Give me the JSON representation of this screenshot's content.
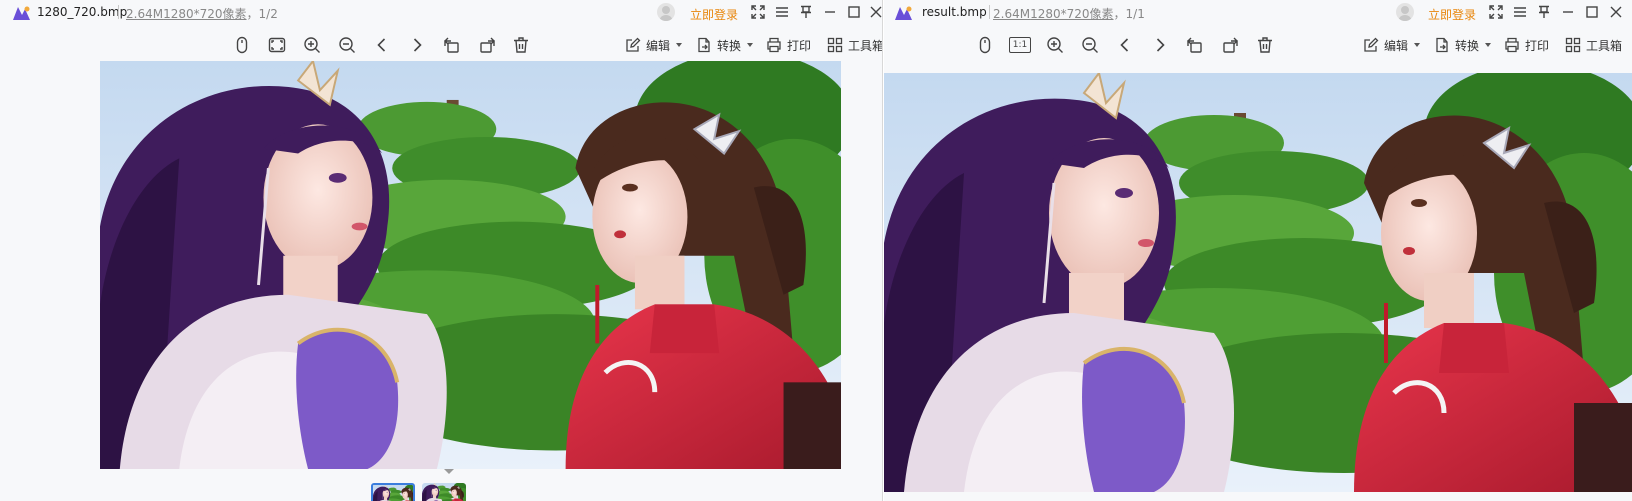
{
  "left_window": {
    "title": "1280_720.bmp",
    "file_size": "2.64M",
    "dimensions": "1280*720像素",
    "page_index": "，1/2",
    "login_label": "立即登录",
    "toolbar": {
      "edit_label": "编辑",
      "convert_label": "转换",
      "print_label": "打印",
      "toolbox_label": "工具箱"
    }
  },
  "right_window": {
    "title": "result.bmp",
    "file_size": "2.64M",
    "dimensions": "1280*720像素",
    "page_index": "，1/1",
    "login_label": "立即登录",
    "toolbar": {
      "actual_size_label": "1:1",
      "edit_label": "编辑",
      "convert_label": "转换",
      "print_label": "打印",
      "toolbox_label": "工具箱"
    }
  },
  "colors": {
    "accent": "#e8860c",
    "selection": "#3b7ddd",
    "icon": "#444444",
    "sky": "#cfe0f2",
    "foliage": "#3f8f2a",
    "hair_purple": "#4a2266",
    "dress_red": "#d42a3e"
  },
  "icons": [
    "app-logo-icon",
    "avatar-icon",
    "fullscreen-icon",
    "menu-icon",
    "pin-icon",
    "minimize-icon",
    "maximize-icon",
    "close-icon",
    "mouse-icon",
    "fit-window-icon",
    "zoom-in-icon",
    "zoom-out-icon",
    "prev-icon",
    "next-icon",
    "rotate-left-icon",
    "rotate-right-icon",
    "delete-icon",
    "edit-icon",
    "convert-icon",
    "print-icon",
    "toolbox-icon"
  ]
}
